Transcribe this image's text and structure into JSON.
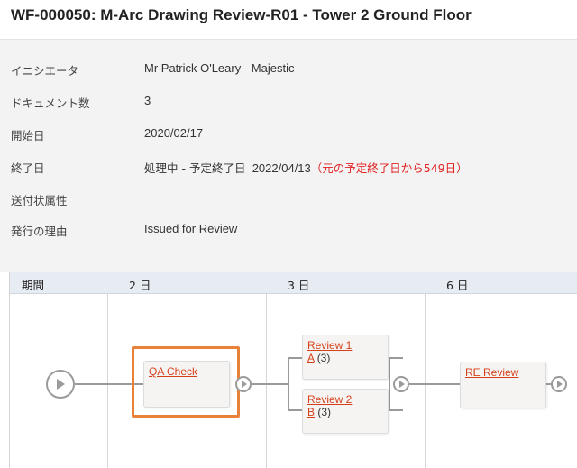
{
  "header": {
    "title": "WF-000050: M-Arc Drawing Review-R01 - Tower 2 Ground Floor"
  },
  "info": {
    "initiator_label": "イニシエータ",
    "initiator_value": "Mr Patrick O'Leary - Majestic",
    "doc_count_label": "ドキュメント数",
    "doc_count_value": "3",
    "start_label": "開始日",
    "start_value": "2020/02/17",
    "end_label": "終了日",
    "end_status": "処理中 - 予定終了日",
    "end_date": "2022/04/13",
    "end_overdue": "（元の予定終了日から549日）",
    "transmittal_label": "送付状属性",
    "transmittal_value": "",
    "reason_label": "発行の理由",
    "reason_value": "Issued for Review"
  },
  "timeline": {
    "period_label": "期間",
    "columns": [
      "2 日",
      "3 日",
      "6 日"
    ],
    "tasks": {
      "qa_check": {
        "name": "QA Check"
      },
      "review1": {
        "name": "Review 1",
        "sub_link": "A",
        "sub_count": "(3)"
      },
      "review2": {
        "name": "Review 2",
        "sub_link": "B",
        "sub_count": "(3)"
      },
      "re_review": {
        "name": "RE Review"
      }
    }
  },
  "colors": {
    "link": "#d4401a",
    "warning": "#e02020",
    "highlight": "#e8813a",
    "timeline_header": "#e7ecf2"
  }
}
